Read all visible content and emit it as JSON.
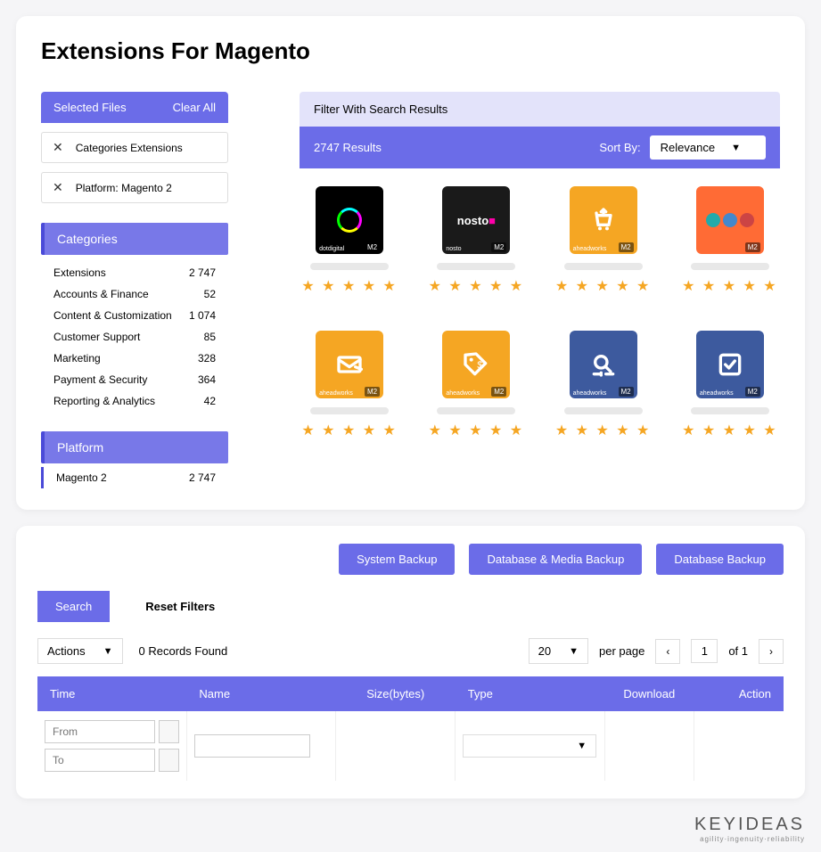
{
  "page_title": "Extensions For Magento",
  "selected": {
    "header": "Selected Files",
    "clear": "Clear All",
    "chips": [
      "Categories Extensions",
      "Platform: Magento 2"
    ]
  },
  "categories": {
    "header": "Categories",
    "items": [
      {
        "label": "Extensions",
        "count": "2 747"
      },
      {
        "label": "Accounts & Finance",
        "count": "52"
      },
      {
        "label": "Content & Customization",
        "count": "1 074"
      },
      {
        "label": "Customer Support",
        "count": "85"
      },
      {
        "label": "Marketing",
        "count": "328"
      },
      {
        "label": "Payment & Security",
        "count": "364"
      },
      {
        "label": "Reporting & Analytics",
        "count": "42"
      }
    ]
  },
  "platform": {
    "header": "Platform",
    "items": [
      {
        "label": "Magento 2",
        "count": "2 747"
      }
    ]
  },
  "filter_label": "Filter With Search Results",
  "results": {
    "count_label": "2747 Results",
    "sort_label": "Sort By:",
    "sort_value": "Relevance"
  },
  "products": [
    {
      "thumb_class": "dotdigital",
      "brand": "dotdigital",
      "badge": "M2",
      "icon": "circle"
    },
    {
      "thumb_class": "nosto",
      "brand": "nosto",
      "badge": "M2",
      "icon": "text-nosto"
    },
    {
      "thumb_class": "aw-orange",
      "brand": "aheadworks",
      "badge": "M2",
      "icon": "cart"
    },
    {
      "thumb_class": "amasty",
      "brand": "",
      "badge": "M2",
      "icon": "amasty"
    },
    {
      "thumb_class": "aw-orange",
      "brand": "aheadworks",
      "badge": "M2",
      "icon": "mail"
    },
    {
      "thumb_class": "aw-orange",
      "brand": "aheadworks",
      "badge": "M2",
      "icon": "tag"
    },
    {
      "thumb_class": "aw-blue",
      "brand": "aheadworks",
      "badge": "M2",
      "icon": "search-sliders"
    },
    {
      "thumb_class": "aw-blue",
      "brand": "aheadworks",
      "badge": "M2",
      "icon": "check"
    }
  ],
  "backups": {
    "system": "System Backup",
    "dbmedia": "Database & Media Backup",
    "db": "Database Backup"
  },
  "tabs": {
    "search": "Search",
    "reset": "Reset Filters"
  },
  "toolbar": {
    "actions": "Actions",
    "found": "0 Records Found",
    "page_size": "20",
    "per_page": "per page",
    "page": "1",
    "of": "of 1"
  },
  "table": {
    "headers": {
      "time": "Time",
      "name": "Name",
      "size": "Size(bytes)",
      "type": "Type",
      "download": "Download",
      "action": "Action"
    },
    "from": "From",
    "to": "To"
  },
  "brand": {
    "name": "KEYIDEAS",
    "tagline": "agility·ingenuity·reliability"
  }
}
